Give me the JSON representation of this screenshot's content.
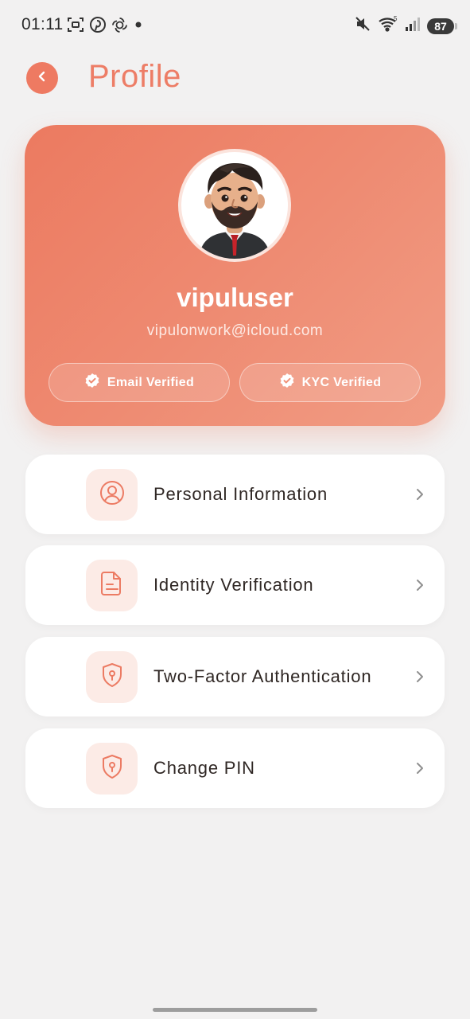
{
  "status_bar": {
    "time": "01:11",
    "battery": "87",
    "left_icons": [
      "screenshot-icon",
      "pinterest-icon",
      "openai-icon",
      "dot-icon"
    ],
    "right_icons": [
      "mute-icon",
      "wifi-icon",
      "signal-icon",
      "battery-icon"
    ]
  },
  "header": {
    "title": "Profile",
    "back_icon": "chevron-left-icon"
  },
  "profile": {
    "username": "vipuluser",
    "email": "vipulonwork@icloud.com",
    "badges": [
      {
        "label": "Email Verified",
        "icon": "verified-check-icon"
      },
      {
        "label": "KYC Verified",
        "icon": "verified-check-icon"
      }
    ]
  },
  "menu": {
    "items": [
      {
        "label": "Personal Information",
        "icon": "user-circle-icon"
      },
      {
        "label": "Identity Verification",
        "icon": "document-icon"
      },
      {
        "label": "Two-Factor Authentication",
        "icon": "shield-keyhole-icon"
      },
      {
        "label": "Change PIN",
        "icon": "shield-keyhole-icon"
      }
    ]
  },
  "colors": {
    "accent": "#ED7D66",
    "card_gradient_start": "#EC7A60",
    "card_gradient_end": "#F19C84",
    "icon_bg": "#FCEBE6",
    "background": "#F2F1F1"
  }
}
